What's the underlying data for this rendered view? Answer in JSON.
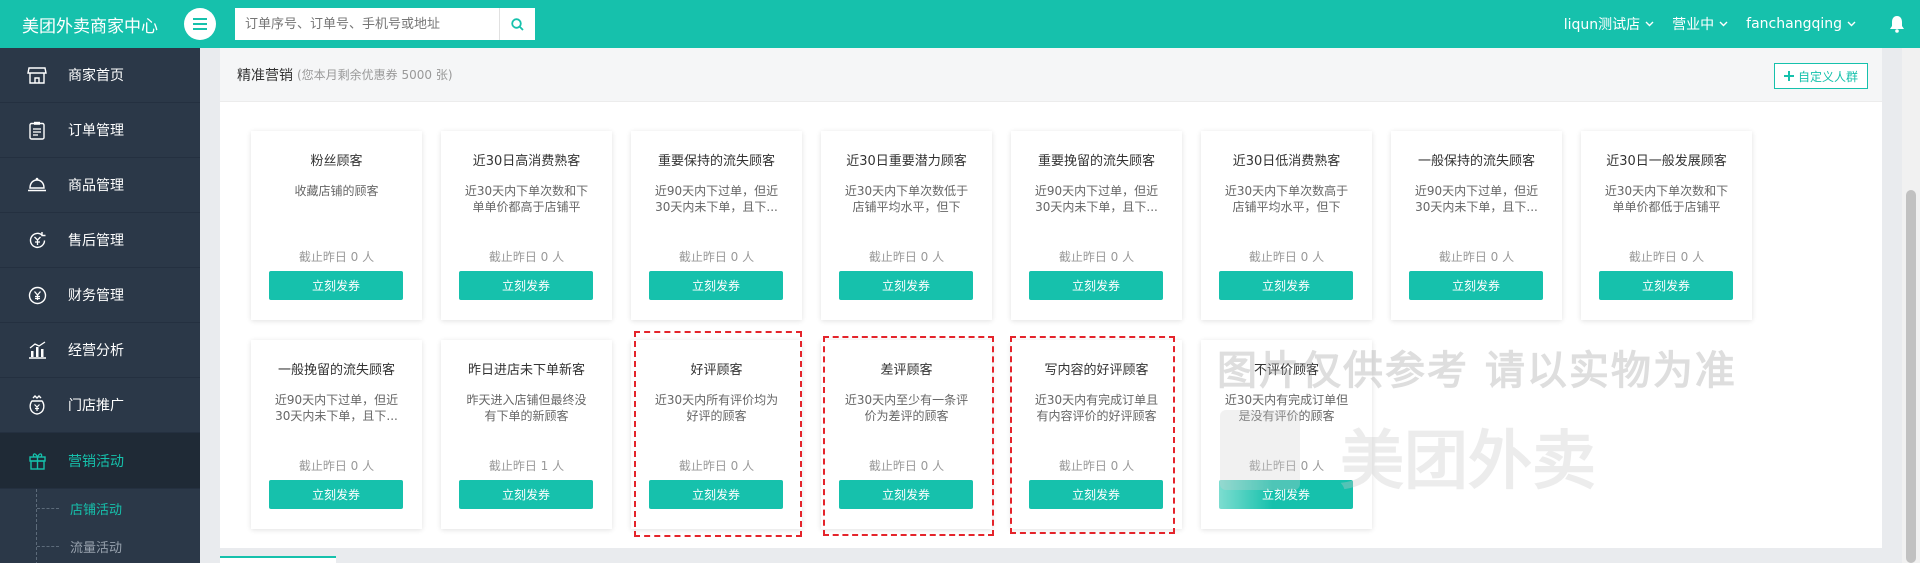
{
  "header": {
    "brand": "美团外卖商家中心",
    "search_placeholder": "订单序号、订单号、手机号或地址",
    "store": "liqun测试店",
    "status": "营业中",
    "user": "fanchangqing"
  },
  "sidebar": {
    "items": [
      {
        "label": "商家首页",
        "icon": "store-icon"
      },
      {
        "label": "订单管理",
        "icon": "clipboard-icon"
      },
      {
        "label": "商品管理",
        "icon": "dish-cover-icon"
      },
      {
        "label": "售后管理",
        "icon": "refund-icon"
      },
      {
        "label": "财务管理",
        "icon": "yuan-circle-icon"
      },
      {
        "label": "经营分析",
        "icon": "chart-icon"
      },
      {
        "label": "门店推广",
        "icon": "promotion-bag-icon"
      },
      {
        "label": "营销活动",
        "icon": "gift-icon"
      }
    ],
    "subitems": [
      {
        "label": "店铺活动"
      },
      {
        "label": "流量活动"
      }
    ]
  },
  "panel": {
    "title": "精准营销",
    "subtitle": "(您本月剩余优惠券 5000 张)",
    "custom_button": "自定义人群"
  },
  "cards": [
    {
      "title": "粉丝顾客",
      "desc": "收藏店铺的顾客",
      "count": "截止昨日 0 人",
      "button": "立刻发券"
    },
    {
      "title": "近30日高消费熟客",
      "desc": "近30天内下单次数和下单单价都高于店铺平均...",
      "count": "截止昨日 0 人",
      "button": "立刻发券"
    },
    {
      "title": "重要保持的流失顾客",
      "desc": "近90天内下过单，但近30天内未下单，且下...",
      "count": "截止昨日 0 人",
      "button": "立刻发券"
    },
    {
      "title": "近30日重要潜力顾客",
      "desc": "近30天内下单次数低于店铺平均水平，但下单...",
      "count": "截止昨日 0 人",
      "button": "立刻发券"
    },
    {
      "title": "重要挽留的流失顾客",
      "desc": "近90天内下过单，但近30天内未下单，且下...",
      "count": "截止昨日 0 人",
      "button": "立刻发券"
    },
    {
      "title": "近30日低消费熟客",
      "desc": "近30天内下单次数高于店铺平均水平，但下单...",
      "count": "截止昨日 0 人",
      "button": "立刻发券"
    },
    {
      "title": "一般保持的流失顾客",
      "desc": "近90天内下过单，但近30天内未下单，且下...",
      "count": "截止昨日 0 人",
      "button": "立刻发券"
    },
    {
      "title": "近30日一般发展顾客",
      "desc": "近30天内下单次数和下单单价都低于店铺平均...",
      "count": "截止昨日 0 人",
      "button": "立刻发券"
    },
    {
      "title": "一般挽留的流失顾客",
      "desc": "近90天内下过单，但近30天内未下单，且下...",
      "count": "截止昨日 0 人",
      "button": "立刻发券"
    },
    {
      "title": "昨日进店未下单新客",
      "desc": "昨天进入店铺但最终没有下单的新顾客",
      "count": "截止昨日 1 人",
      "button": "立刻发券"
    },
    {
      "title": "好评顾客",
      "desc": "近30天内所有评价均为好评的顾客",
      "count": "截止昨日 0 人",
      "button": "立刻发券"
    },
    {
      "title": "差评顾客",
      "desc": "近30天内至少有一条评价为差评的顾客",
      "count": "截止昨日 0 人",
      "button": "立刻发券"
    },
    {
      "title": "写内容的好评顾客",
      "desc": "近30天内有完成订单且有内容评价的好评顾客",
      "count": "截止昨日 0 人",
      "button": "立刻发券"
    },
    {
      "title": "不评价顾客",
      "desc": "近30天内有完成订单但是没有评价的顾客",
      "count": "截止昨日 0 人",
      "button": "立刻发券"
    }
  ],
  "watermark": {
    "line1": "图片仅供参考 请以实物为准",
    "line2": "美团外卖"
  },
  "colors": {
    "accent": "#16c1ac",
    "sidebar": "#2b3848",
    "highlight": "#e4242b"
  }
}
